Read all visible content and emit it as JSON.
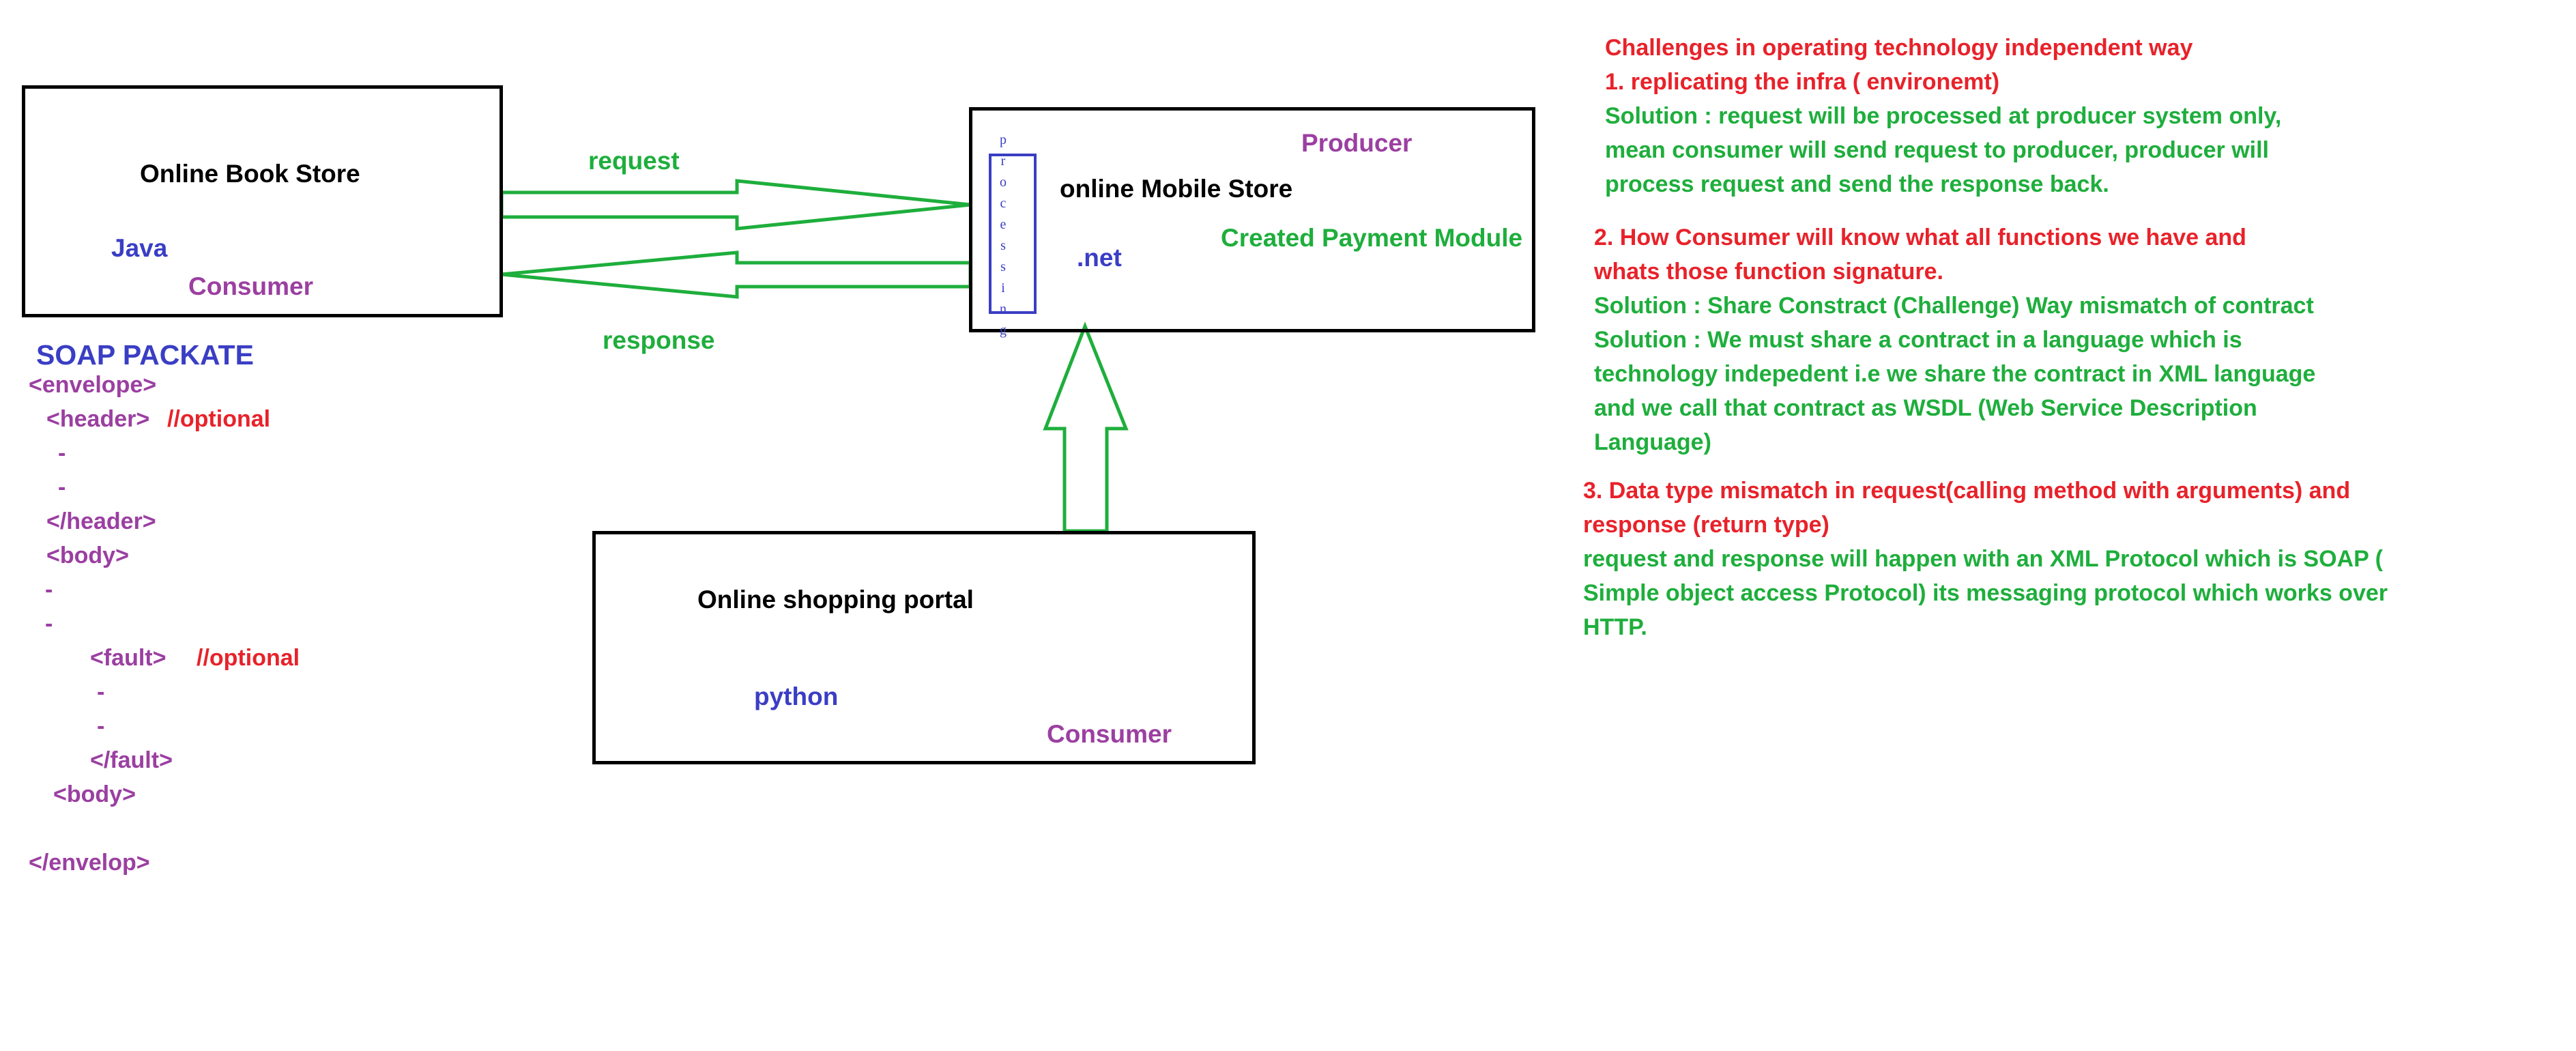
{
  "colors": {
    "black": "#000000",
    "purple": "#9b3fa1",
    "blue": "#3a3ec4",
    "green": "#1eae3c",
    "red": "#e8222a"
  },
  "book_store": {
    "title": "Online Book Store",
    "tech": "Java",
    "role": "Consumer"
  },
  "arrows": {
    "request_label": "request",
    "response_label": "response"
  },
  "mobile_store": {
    "title": "online Mobile Store",
    "role": "Producer",
    "tech": ".net",
    "module": "Created Payment Module",
    "processing_letters": [
      "p",
      "r",
      "o",
      "c",
      "e",
      "s",
      "s",
      "i",
      "n",
      "g"
    ]
  },
  "shopping_portal": {
    "title": "Online shopping portal",
    "tech": "python",
    "role": "Consumer"
  },
  "soap": {
    "heading": "SOAP PACKATE",
    "lines": [
      {
        "text": "<envelope>",
        "comment": ""
      },
      {
        "text": "<header>",
        "comment": "//optional"
      },
      {
        "text": "-",
        "comment": ""
      },
      {
        "text": "-",
        "comment": ""
      },
      {
        "text": "</header>",
        "comment": ""
      },
      {
        "text": "<body>",
        "comment": ""
      },
      {
        "text": "-",
        "comment": ""
      },
      {
        "text": "-",
        "comment": ""
      },
      {
        "text": "<fault>",
        "comment": "//optional"
      },
      {
        "text": "-",
        "comment": ""
      },
      {
        "text": "-",
        "comment": ""
      },
      {
        "text": "</fault>",
        "comment": ""
      },
      {
        "text": "<body>",
        "comment": ""
      },
      {
        "text": "</envelop>",
        "comment": ""
      }
    ]
  },
  "challenges": {
    "heading": "Challenges in operating technology independent way",
    "c1_title": "1. replicating the infra ( environemt)",
    "c1_solution": [
      "Solution : request will be processed at producer system only,",
      "mean consumer will send request to producer, producer will",
      "process request and send the response back."
    ],
    "c2_title": [
      "2. How Consumer will know what all functions we have and",
      "whats those function signature."
    ],
    "c2_solution": [
      "Solution : Share Constract (Challenge) Way mismatch of contract",
      "Solution : We must share a contract in a language which is",
      "technology indepedent i.e we share the contract in XML language",
      "and we call that contract as WSDL (Web Service Description",
      "Language)"
    ],
    "c3_title": [
      "3. Data type mismatch in request(calling method with arguments) and",
      "response (return type)"
    ],
    "c3_solution": [
      "request and response will happen with an XML Protocol which is SOAP (",
      "Simple object access Protocol) its messaging protocol which works over",
      "HTTP."
    ]
  }
}
